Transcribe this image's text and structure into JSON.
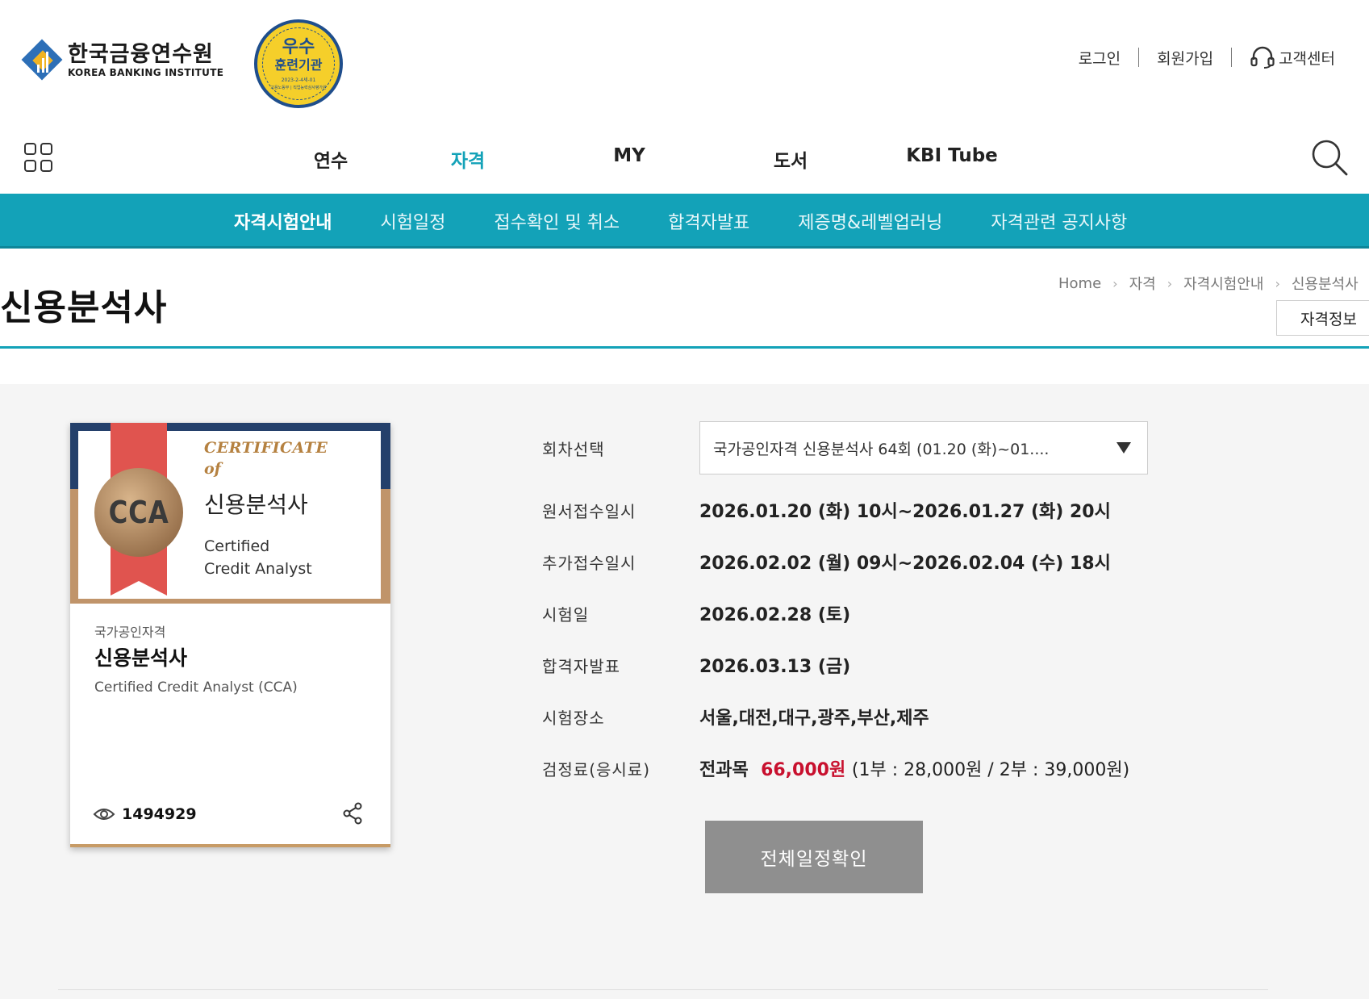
{
  "header": {
    "logo_ko": "한국금융연수원",
    "logo_en": "KOREA BANKING INSTITUTE",
    "badge_line1": "우수",
    "badge_line2": "훈련기관",
    "badge_line3": "2023-2-4세-01",
    "badge_line4": "고용노동부 | 직업능력심사평가원",
    "util": {
      "login": "로그인",
      "signup": "회원가입",
      "customer_center": "고객센터"
    },
    "gnb": [
      "연수",
      "자격",
      "MY",
      "도서",
      "KBI Tube"
    ],
    "gnb_active_index": 1,
    "accent_color": "#13a2b8"
  },
  "lnb": {
    "items": [
      "자격시험안내",
      "시험일정",
      "접수확인 및 취소",
      "합격자발표",
      "제증명&레벨업러닝",
      "자격관련 공지사항"
    ],
    "active_index": 0
  },
  "page": {
    "title": "신용분석사",
    "breadcrumb": [
      "Home",
      "자격",
      "자격시험안내",
      "신용분석사"
    ],
    "info_button": "자격정보"
  },
  "card": {
    "cert_label": "CERTIFICATE",
    "cert_of": "of",
    "seal_text": "CCA",
    "cert_name": "신용분석사",
    "cert_en_line1": "Certified",
    "cert_en_line2": "Credit Analyst",
    "category": "국가공인자격",
    "name": "신용분석사",
    "name_en": "Certified Credit Analyst (CCA)",
    "views": "1494929"
  },
  "detail": {
    "session_label": "회차선택",
    "session_selected": "국가공인자격 신용분석사 64회 (01.20 (화)~01....",
    "rows": [
      {
        "label": "원서접수일시",
        "value": "2026.01.20 (화) 10시~2026.01.27 (화) 20시"
      },
      {
        "label": "추가접수일시",
        "value": "2026.02.02 (월) 09시~2026.02.04 (수) 18시"
      },
      {
        "label": "시험일",
        "value": "2026.02.28 (토)"
      },
      {
        "label": "합격자발표",
        "value": "2026.03.13 (금)"
      },
      {
        "label": "시험장소",
        "value": "서울,대전,대구,광주,부산,제주"
      }
    ],
    "fee_label": "검정료(응시료)",
    "fee_prefix": "전과목",
    "fee_amount": "66,000원",
    "fee_detail": "(1부 : 28,000원 / 2부 : 39,000원)",
    "full_schedule_button": "전체일정확인"
  }
}
